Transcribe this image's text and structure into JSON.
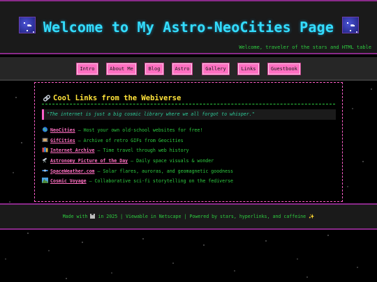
{
  "header": {
    "title": "Welcome to My Astro-NeoCities Page",
    "tagline": "Welcome, traveler of the stars and HTML table",
    "left_icon": "space-planet-icon",
    "right_icon": "space-planet-icon"
  },
  "nav": {
    "items": [
      {
        "label": "Intro"
      },
      {
        "label": "About Me"
      },
      {
        "label": "Blog"
      },
      {
        "label": "Astro"
      },
      {
        "label": "Gallery"
      },
      {
        "label": "Links"
      },
      {
        "label": "Guestbook"
      }
    ]
  },
  "main": {
    "section_icon": "link-icon",
    "section_title": "Cool Links from the Webiverse",
    "quote": "\"The internet is just a big cosmic library where we all forgot to whisper.\"",
    "links": [
      {
        "icon": "globe-icon",
        "name": "NeoCities",
        "desc": " — Host your own old-school websites for free!"
      },
      {
        "icon": "film-icon",
        "name": "GifCities",
        "desc": " — Archive of retro GIFs from Geocities"
      },
      {
        "icon": "books-icon",
        "name": "Internet Archive",
        "desc": " — Time travel through web history"
      },
      {
        "icon": "telescope-icon",
        "name": "Astronomy Picture of the Day",
        "desc": " — Daily space visuals & wonder"
      },
      {
        "icon": "satellite-icon",
        "name": "SpaceWeather.com",
        "desc": " — Solar flares, auroras, and geomagnetic goodness"
      },
      {
        "icon": "mountain-icon",
        "name": "Cosmic Voyage",
        "desc": " — Collaborative sci-fi storytelling on the fediverse"
      }
    ]
  },
  "footer": {
    "before_icon": "Made with ",
    "icon": "floppy-disk-icon",
    "after_icon": " in 2025 | Viewable in Netscape | Powered by stars, hyperlinks, and caffeine ✨"
  },
  "colors": {
    "title_cyan": "#33ddff",
    "nav_pink": "#ff6fc1",
    "terminal_green": "#2ecc40",
    "heading_yellow": "#ffe23a",
    "frame_purple": "#8a2a8a"
  }
}
